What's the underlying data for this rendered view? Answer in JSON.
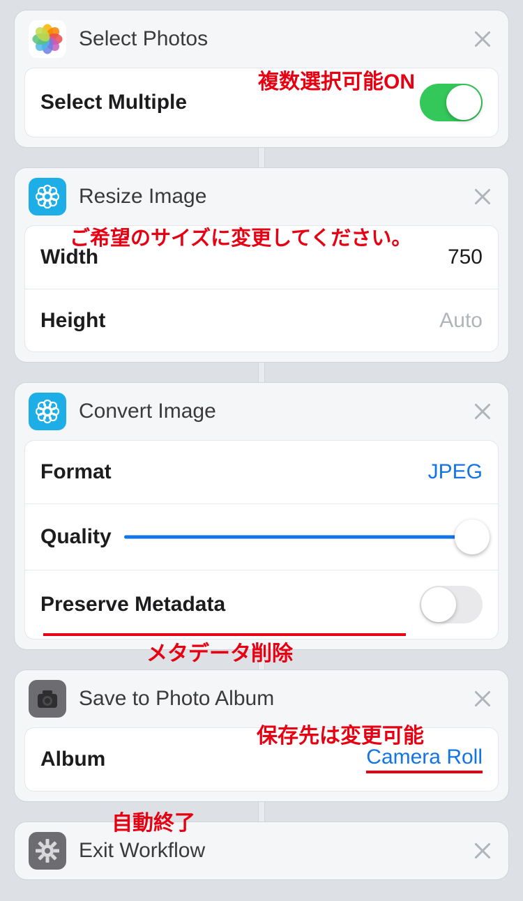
{
  "cards": {
    "selectPhotos": {
      "title": "Select Photos",
      "rows": {
        "selectMultiple": {
          "label": "Select Multiple",
          "on": true
        }
      }
    },
    "resizeImage": {
      "title": "Resize Image",
      "rows": {
        "width": {
          "label": "Width",
          "value": "750"
        },
        "height": {
          "label": "Height",
          "value": "Auto"
        }
      }
    },
    "convertImage": {
      "title": "Convert Image",
      "rows": {
        "format": {
          "label": "Format",
          "value": "JPEG"
        },
        "quality": {
          "label": "Quality",
          "value": 100
        },
        "metadata": {
          "label": "Preserve Metadata",
          "on": false
        }
      }
    },
    "saveAlbum": {
      "title": "Save to Photo Album",
      "rows": {
        "album": {
          "label": "Album",
          "value": "Camera Roll"
        }
      }
    },
    "exit": {
      "title": "Exit Workflow"
    }
  },
  "annotations": {
    "multiOn": "複数選択可能ON",
    "resizeMsg": "ご希望のサイズに変更してください。",
    "metaDel": "メタデータ削除",
    "saveDest": "保存先は変更可能",
    "autoExit": "自動終了"
  }
}
